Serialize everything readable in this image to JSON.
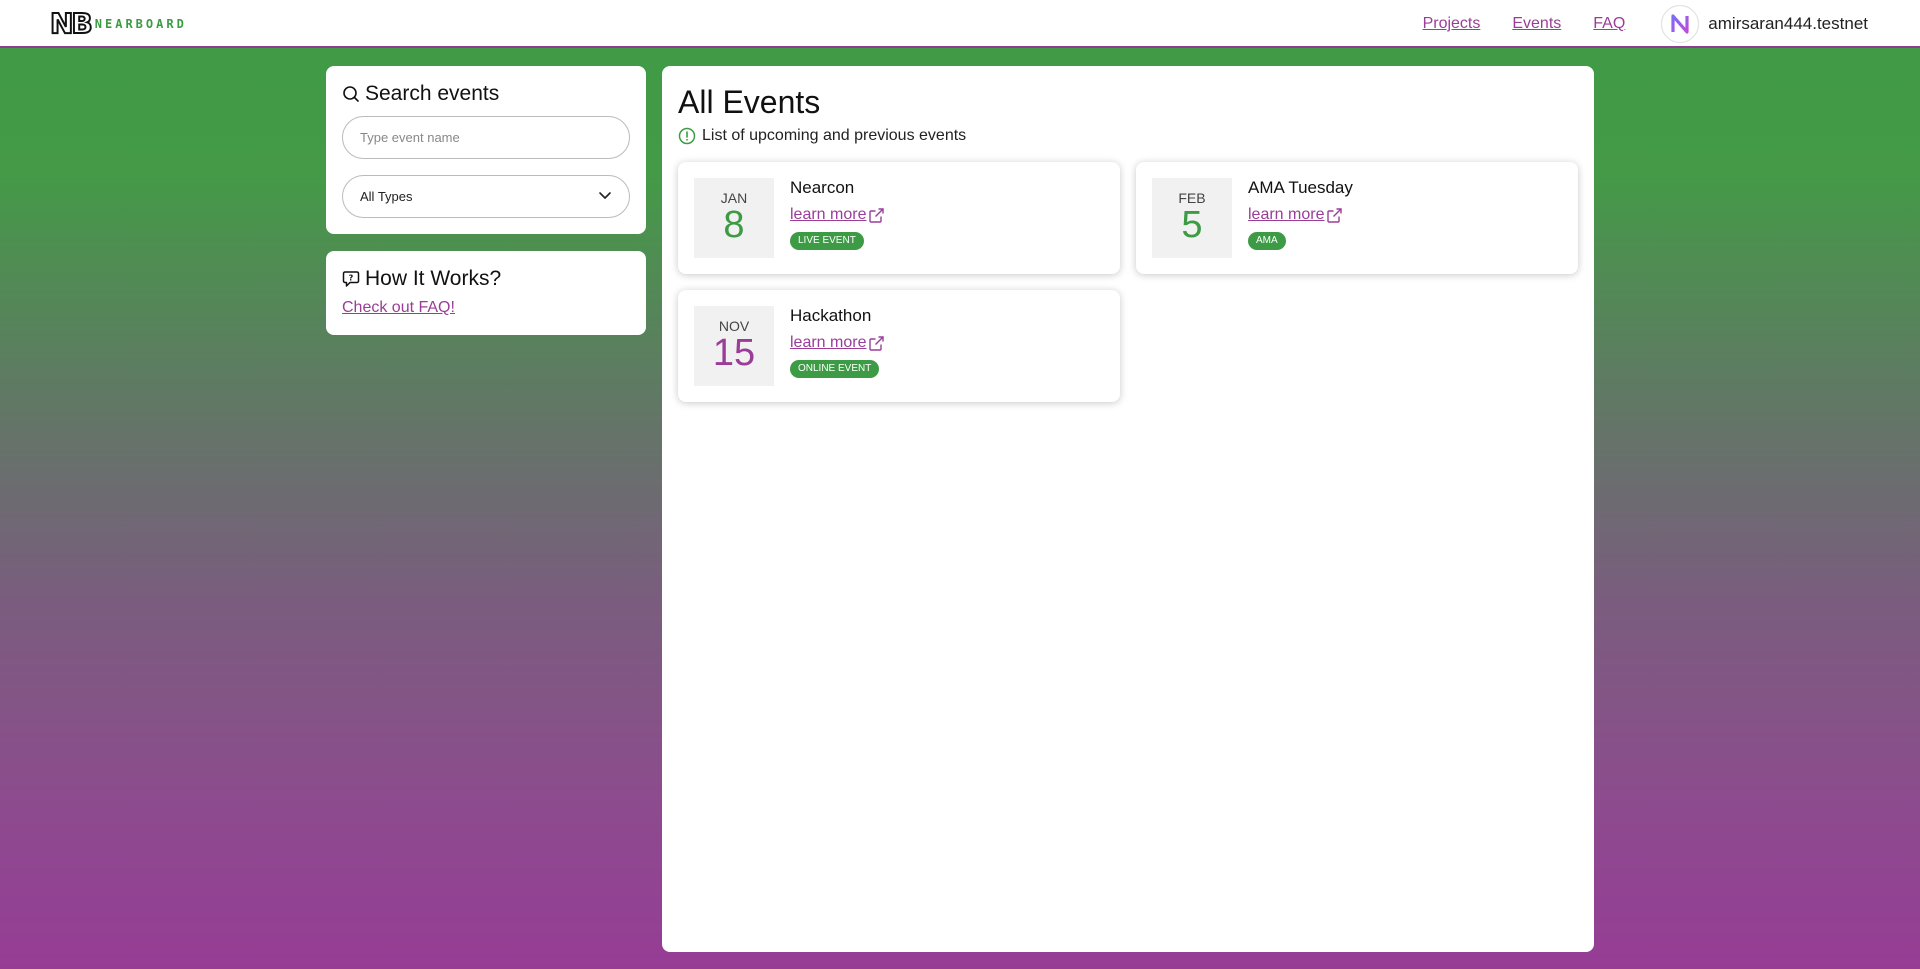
{
  "header": {
    "logo_mark": "NB",
    "logo_text": "NEARBOARD",
    "nav": [
      {
        "label": "Projects"
      },
      {
        "label": "Events"
      },
      {
        "label": "FAQ"
      }
    ],
    "user": {
      "name": "amirsaran444.testnet",
      "avatar_icon": "near-logo-icon"
    }
  },
  "sidebar": {
    "search": {
      "title": "Search events",
      "icon": "search-icon",
      "placeholder": "Type event name",
      "value": "",
      "type_select": {
        "selected": "All Types",
        "icon": "chevron-down-icon"
      }
    },
    "how_it_works": {
      "title": "How It Works?",
      "icon": "chat-bubble-icon",
      "link": "Check out FAQ!"
    }
  },
  "main": {
    "title": "All Events",
    "subtitle": "List of upcoming and previous events",
    "subtitle_icon": "info-circle-icon",
    "events": [
      {
        "month": "JAN",
        "day": "8",
        "name": "Nearcon",
        "link": "learn more",
        "badge": "LIVE EVENT"
      },
      {
        "month": "FEB",
        "day": "5",
        "name": "AMA Tuesday",
        "link": "learn more",
        "badge": "AMA"
      },
      {
        "month": "NOV",
        "day": "15",
        "name": "Hackathon",
        "link": "learn more",
        "badge": "ONLINE EVENT"
      }
    ]
  },
  "colors": {
    "brand_green": "#3c9b44",
    "brand_purple": "#9a3d98"
  }
}
